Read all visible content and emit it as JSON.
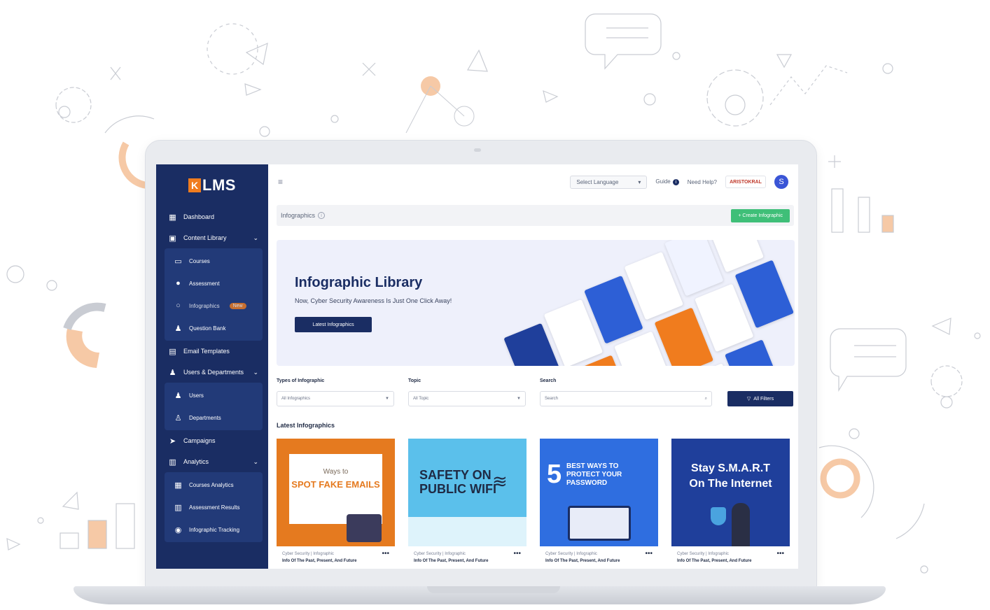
{
  "sidebar": {
    "logo_mark": "K",
    "logo_text": "LMS",
    "items": [
      {
        "label": "Dashboard",
        "icon": "grid-icon"
      },
      {
        "label": "Content Library",
        "icon": "briefcase-icon"
      },
      {
        "label": "Courses",
        "icon": "presentation-icon"
      },
      {
        "label": "Assessment",
        "icon": "search-icon"
      },
      {
        "label": "Infographics",
        "icon": "circle-icon",
        "badge": "New"
      },
      {
        "label": "Question Bank",
        "icon": "user-icon"
      },
      {
        "label": "Email Templates",
        "icon": "template-icon"
      },
      {
        "label": "Users & Departments",
        "icon": "user-icon"
      },
      {
        "label": "Users",
        "icon": "users-icon"
      },
      {
        "label": "Departments",
        "icon": "org-icon"
      },
      {
        "label": "Campaigns",
        "icon": "send-icon"
      },
      {
        "label": "Analytics",
        "icon": "clipboard-icon"
      },
      {
        "label": "Courses Analytics",
        "icon": "chart-icon"
      },
      {
        "label": "Assessment Results",
        "icon": "clipboard-icon"
      },
      {
        "label": "Infographic Tracking",
        "icon": "tracking-icon"
      }
    ]
  },
  "topbar": {
    "hamburger": "≡",
    "language_label": "Select Language",
    "guide_label": "Guide",
    "help_label": "Need Help?",
    "avatar_initial": "S",
    "org_logo_text": "ARISTOKRAL"
  },
  "page": {
    "title": "Infographics",
    "create_label": "+ Create Infographic"
  },
  "banner": {
    "title": "Infographic Library",
    "subtitle": "Now, Cyber Security Awareness Is Just One Click Away!",
    "button_label": "Latest Infographics"
  },
  "filters": {
    "type_label": "Types of Infographic",
    "type_value": "All Infographics",
    "topic_label": "Topic",
    "topic_value": "All Topic",
    "search_label": "Search",
    "search_placeholder": "Search",
    "all_filters_label": "All Filters"
  },
  "section_title": "Latest Infographics",
  "cards": [
    {
      "line1": "Ways to",
      "line2": "SPOT FAKE EMAILS",
      "meta": "Cyber Security | Infographic",
      "sub": "Info Of The Past, Present, And Future"
    },
    {
      "line1": "SAFETY ON",
      "line2": "PUBLIC WIFI",
      "meta": "Cyber Security | Infographic",
      "sub": "Info Of The Past, Present, And Future"
    },
    {
      "line1": "5",
      "line2": "BEST WAYS TO PROTECT YOUR PASSWORD",
      "meta": "Cyber Security | Infographic",
      "sub": "Info Of The Past, Present, And Future"
    },
    {
      "line1": "Stay S.M.A.R.T",
      "line2": "On The Internet",
      "meta": "Cyber Security | Infographic",
      "sub": "Info Of The Past, Present, And Future"
    }
  ],
  "colors": {
    "sidebar": "#1a2d63",
    "accent": "#f07c1e",
    "primary_button": "#1a2d63",
    "create_button": "#3fbf78"
  }
}
